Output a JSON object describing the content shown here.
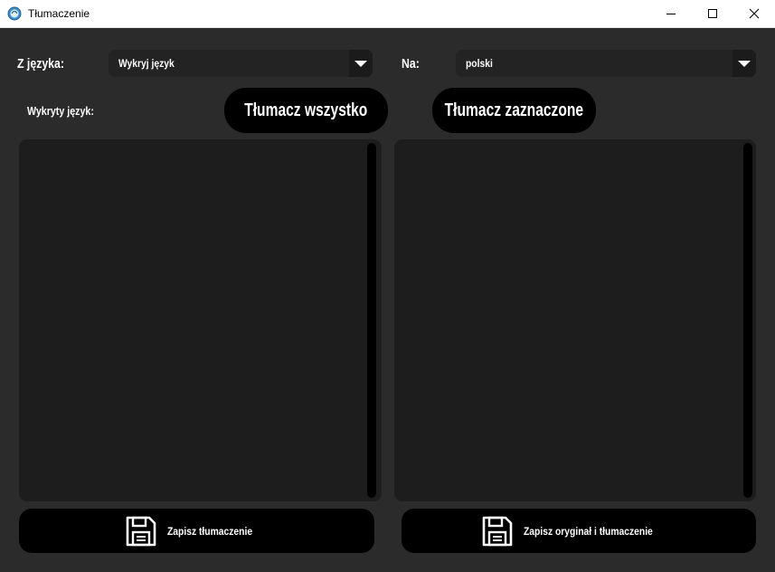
{
  "window": {
    "title": "Tłumaczenie",
    "icon": "app-logo-icon",
    "controls": [
      "minimize-icon",
      "maximize-icon",
      "close-icon"
    ]
  },
  "source": {
    "label": "Z języka:",
    "selected": "Wykryj język",
    "detected_label": "Wykryty język:",
    "detected_value": ""
  },
  "target": {
    "label": "Na:",
    "selected": "polski"
  },
  "actions": {
    "translate_all": "Tłumacz wszystko",
    "translate_selected": "Tłumacz zaznaczone"
  },
  "editors": {
    "source_text": "",
    "translated_text": ""
  },
  "save": {
    "save_translation": "Zapisz tłumaczenie",
    "save_both": "Zapisz oryginał i tłumaczenie",
    "icon": "floppy-disk-icon"
  },
  "colors": {
    "background": "#2b2b2b",
    "field": "#232323",
    "textbox": "#1d1d1d",
    "button": "#000000",
    "text": "#ffffff"
  }
}
